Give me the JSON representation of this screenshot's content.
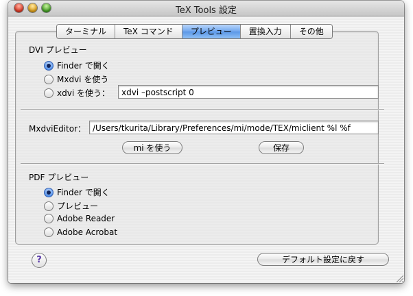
{
  "window": {
    "title": "TeX Tools 設定"
  },
  "tabs": [
    {
      "label": "ターミナル",
      "active": false
    },
    {
      "label": "TeX コマンド",
      "active": false
    },
    {
      "label": "プレビュー",
      "active": true
    },
    {
      "label": "置換入力",
      "active": false
    },
    {
      "label": "その他",
      "active": false
    }
  ],
  "dvi": {
    "heading": "DVI プレビュー",
    "options": [
      {
        "label": "Finder で開く",
        "selected": true
      },
      {
        "label": "Mxdvi を使う",
        "selected": false
      },
      {
        "label": "xdvi を使う：",
        "selected": false
      }
    ],
    "xdvi_command": "xdvi –postscript 0"
  },
  "mxdvi": {
    "label": "MxdviEditor：",
    "value": "/Users/tkurita/Library/Preferences/mi/mode/TEX/miclient %l %f",
    "use_mi_button": "mi を使う",
    "save_button": "保存"
  },
  "pdf": {
    "heading": "PDF プレビュー",
    "options": [
      {
        "label": "Finder で開く",
        "selected": true
      },
      {
        "label": "プレビュー",
        "selected": false
      },
      {
        "label": "Adobe Reader",
        "selected": false
      },
      {
        "label": "Adobe Acrobat",
        "selected": false
      }
    ]
  },
  "footer": {
    "help_label": "?",
    "restore_defaults_button": "デフォルト設定に戻す"
  },
  "colors": {
    "accent": "#5a96e6",
    "help": "#5a3aa8"
  }
}
